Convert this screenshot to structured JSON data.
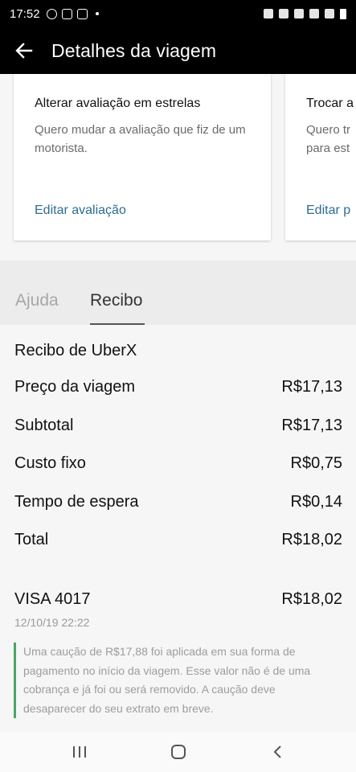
{
  "status_bar": {
    "time": "17:52"
  },
  "header": {
    "title": "Detalhes da viagem"
  },
  "cards": [
    {
      "title": "Alterar avaliação em estrelas",
      "description": "Quero mudar a avaliação que fiz de um motorista.",
      "link": "Editar avaliação"
    },
    {
      "title": "Trocar a",
      "description": "Quero tr para est",
      "link": "Editar p"
    }
  ],
  "tabs": {
    "help": "Ajuda",
    "receipt": "Recibo"
  },
  "receipt": {
    "title": "Recibo de UberX",
    "lines": [
      {
        "label": "Preço da viagem",
        "amount": "R$17,13"
      },
      {
        "label": "Subtotal",
        "amount": "R$17,13"
      },
      {
        "label": "Custo fixo",
        "amount": "R$0,75"
      },
      {
        "label": "Tempo de espera",
        "amount": "R$0,14"
      },
      {
        "label": "Total",
        "amount": "R$18,02"
      }
    ],
    "payment": {
      "method": "VISA 4017",
      "amount": "R$18,02",
      "date": "12/10/19 22:22"
    },
    "notice": "Uma caução de R$17,88 foi aplicada em sua forma de pagamento no início da viagem. Esse valor não é de uma cobrança e já foi ou será removido. A caução deve desaparecer do seu extrato em breve."
  },
  "colors": {
    "header_bg": "#000000",
    "link": "#2c6d90",
    "notice_bar": "#4aa564"
  }
}
